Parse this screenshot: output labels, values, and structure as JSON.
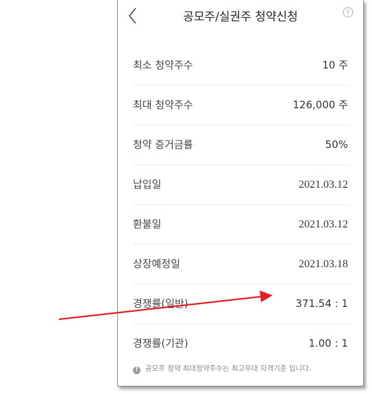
{
  "header": {
    "title": "공모주/실권주 청약신청",
    "back_icon": "chevron-left-icon",
    "help_icon": "question-circle-icon"
  },
  "rows": [
    {
      "label": "최소 청약주수",
      "value": "10 주"
    },
    {
      "label": "최대 청약주수",
      "value": "126,000 주"
    },
    {
      "label": "청약 증거금률",
      "value": "50%"
    },
    {
      "label": "납입일",
      "value": "2021.03.12"
    },
    {
      "label": "환불일",
      "value": "2021.03.12"
    },
    {
      "label": "상장예정일",
      "value": "2021.03.18"
    },
    {
      "label": "경쟁률(일반)",
      "value": "371.54 : 1"
    },
    {
      "label": "경쟁률(기관)",
      "value": "1.00 : 1"
    }
  ],
  "notice": {
    "icon": "info-icon",
    "icon_glyph": "!",
    "text": "공모주 청약 최대청약주수는 최고우대 자격기준 입니다."
  },
  "annotation": {
    "color": "#e31e24",
    "target_row": "경쟁률(일반)"
  }
}
